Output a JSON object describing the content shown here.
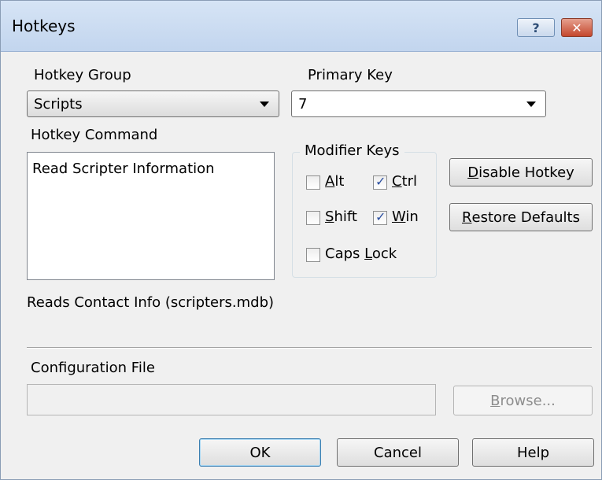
{
  "window": {
    "title": "Hotkeys",
    "help_glyph": "?",
    "close_glyph": "✕"
  },
  "hotkey_group": {
    "label": "Hotkey Group",
    "value": "Scripts"
  },
  "primary_key": {
    "label": "Primary Key",
    "value": "7"
  },
  "hotkey_command": {
    "label": "Hotkey Command",
    "items": [
      "Read Scripter Information"
    ]
  },
  "modifier_keys": {
    "label": "Modifier Keys",
    "alt": {
      "mnemonic": "A",
      "rest": "lt",
      "checked": false
    },
    "ctrl": {
      "mnemonic": "C",
      "rest": "trl",
      "checked": true
    },
    "shift": {
      "mnemonic": "S",
      "rest": "hift",
      "checked": false
    },
    "win": {
      "mnemonic": "W",
      "rest": "in",
      "checked": true
    },
    "caps_lock": {
      "pre": "Caps ",
      "mnemonic": "L",
      "rest": "ock",
      "checked": false
    }
  },
  "buttons": {
    "disable_hotkey": {
      "mnemonic": "D",
      "rest": "isable Hotkey"
    },
    "restore_defaults": {
      "mnemonic": "R",
      "rest": "estore Defaults"
    },
    "browse": {
      "mnemonic": "B",
      "rest": "rowse..."
    },
    "ok": "OK",
    "cancel": "Cancel",
    "help": "Help"
  },
  "description": "Reads Contact Info (scripters.mdb)",
  "configuration_file": {
    "label": "Configuration File",
    "value": ""
  },
  "colors": {
    "check_mark": "#2b4fa0",
    "title_bar": "#c8d9f0",
    "close_button": "#c4472d"
  },
  "icons": {
    "help": "question-mark-icon",
    "close": "close-x-icon",
    "dropdown": "chevron-down-icon",
    "check": "check-mark-icon"
  }
}
